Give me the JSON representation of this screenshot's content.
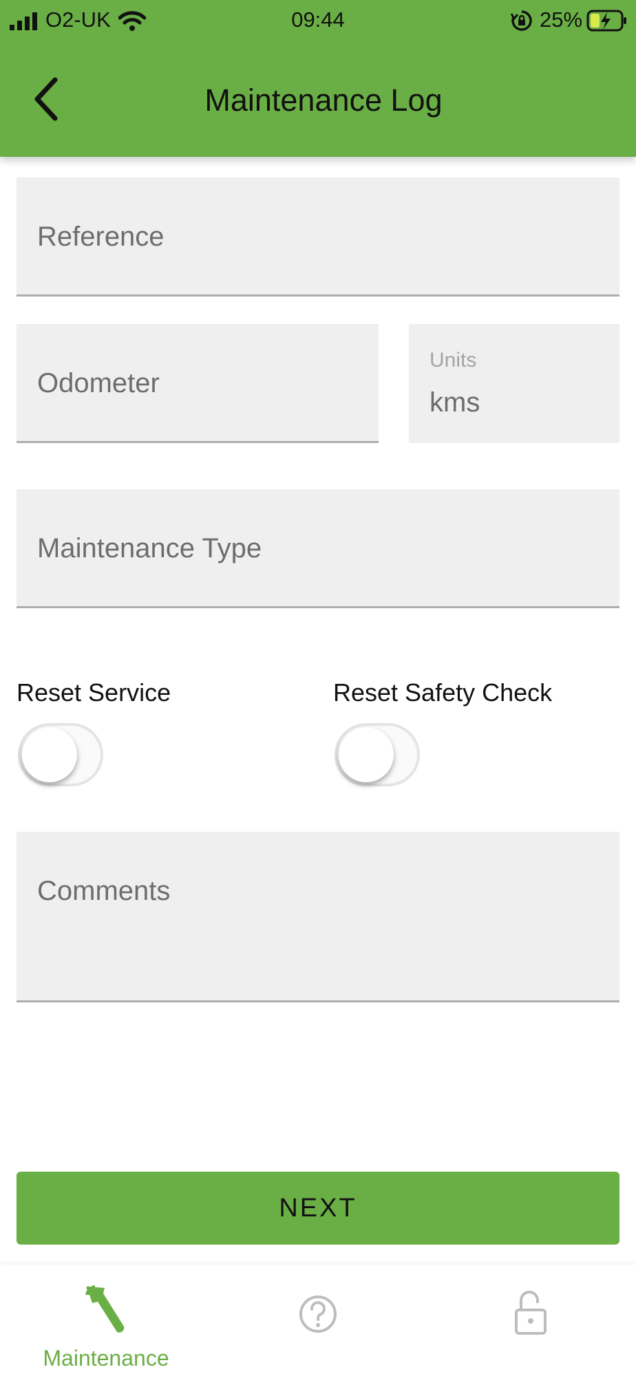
{
  "theme": {
    "accent": "#6aaf45"
  },
  "status_bar": {
    "carrier": "O2-UK",
    "time": "09:44",
    "battery": "25%"
  },
  "header": {
    "title": "Maintenance Log",
    "back_icon": "chevron-left-icon"
  },
  "form": {
    "reference": {
      "placeholder": "Reference",
      "value": ""
    },
    "odometer": {
      "placeholder": "Odometer",
      "value": ""
    },
    "units": {
      "label": "Units",
      "value": "kms"
    },
    "maintenance_type": {
      "placeholder": "Maintenance Type",
      "value": ""
    },
    "reset_service": {
      "label": "Reset Service",
      "on": false
    },
    "reset_safety_check": {
      "label": "Reset Safety Check",
      "on": false
    },
    "comments": {
      "placeholder": "Comments",
      "value": ""
    }
  },
  "next_button": {
    "label": "NEXT"
  },
  "tab_bar": {
    "tabs": [
      {
        "label": "Maintenance",
        "icon": "wrench-icon",
        "active": true
      },
      {
        "label": "",
        "icon": "help-icon",
        "active": false
      },
      {
        "label": "",
        "icon": "lock-icon",
        "active": false
      }
    ]
  }
}
